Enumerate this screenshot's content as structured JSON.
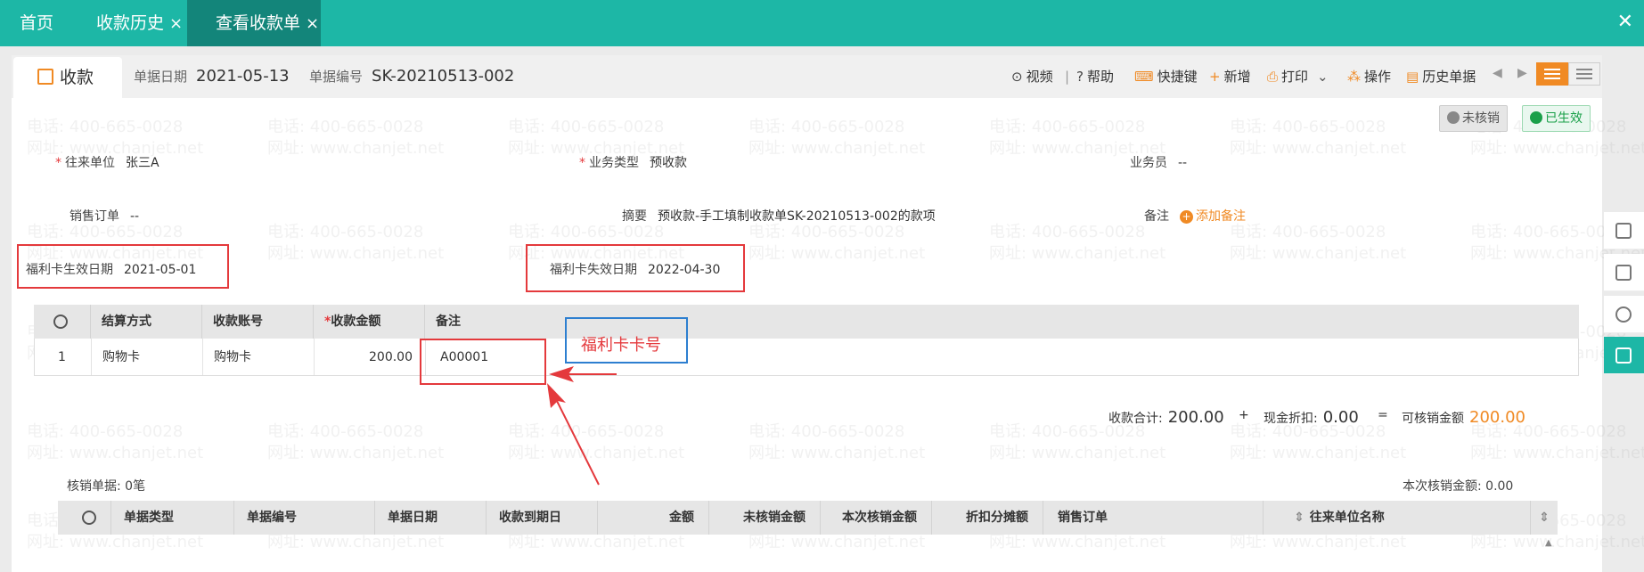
{
  "tabs": [
    {
      "label": "首页",
      "closable": false,
      "active": false
    },
    {
      "label": "收款历史",
      "closable": true,
      "active": false
    },
    {
      "label": "查看收款单",
      "closable": true,
      "active": true
    }
  ],
  "doc": {
    "type_label": "收款",
    "date_key": "单据日期",
    "date_value": "2021-05-13",
    "no_key": "单据编号",
    "no_value": "SK-20210513-002"
  },
  "toolbar": {
    "video": "视频",
    "help": "帮助",
    "shortcut": "快捷键",
    "add": "新增",
    "print": "打印",
    "ops": "操作",
    "history": "历史单据",
    "sep": "|"
  },
  "status": {
    "unverified": "未核销",
    "effective": "已生效"
  },
  "form": {
    "partner_key": "往来单位",
    "partner_value": "张三A",
    "biz_type_key": "业务类型",
    "biz_type_value": "预收款",
    "salesman_key": "业务员",
    "salesman_value": "--",
    "sales_order_key": "销售订单",
    "sales_order_value": "--",
    "summary_key": "摘要",
    "summary_value": "预收款-手工填制收款单SK-20210513-002的款项",
    "remark_key": "备注",
    "add_remark": "添加备注",
    "card_start_key": "福利卡生效日期",
    "card_start_value": "2021-05-01",
    "card_end_key": "福利卡失效日期",
    "card_end_value": "2022-04-30"
  },
  "settle_table": {
    "headers": [
      "结算方式",
      "收款账号",
      "收款金额",
      "备注"
    ],
    "rows": [
      {
        "idx": "1",
        "method": "购物卡",
        "account": "购物卡",
        "amount": "200.00",
        "remark": "A00001"
      }
    ]
  },
  "annotation": {
    "card_no_label": "福利卡卡号"
  },
  "totals": {
    "received_key": "收款合计:",
    "received_value": "200.00",
    "plus": "+",
    "discount_key": "现金折扣:",
    "discount_value": "0.00",
    "equals": "=",
    "verifiable_key": "可核销金额",
    "verifiable_value": "200.00"
  },
  "verify_table": {
    "caption_left": "核销单据: 0笔",
    "caption_right": "本次核销金额: 0.00",
    "headers": [
      "单据类型",
      "单据编号",
      "单据日期",
      "收款到期日",
      "金额",
      "未核销金额",
      "本次核销金额",
      "折扣分摊额",
      "销售订单",
      "往来单位名称"
    ]
  },
  "watermark": {
    "phone": "电话: 400-665-0028",
    "site": "网址: www.chanjet.net"
  },
  "colors": {
    "teal": "#1db7a6",
    "teal_dark": "#13857a",
    "orange": "#f08a24",
    "red": "#e4393c",
    "blue": "#2d7fd0"
  }
}
